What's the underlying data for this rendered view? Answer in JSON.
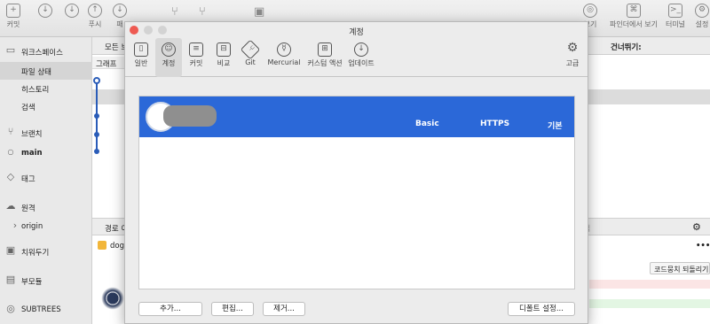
{
  "toolbar": {
    "commit_label": "커밋",
    "push_label": "푸시",
    "fetch_label": "패",
    "view_label": "보기",
    "finder_label": "파인더에서 보기",
    "terminal_label": "터미널",
    "settings_label": "설정"
  },
  "sidebar": {
    "workspace": "워크스페이스",
    "file_status": "파일 상태",
    "history": "히스토리",
    "search": "검색",
    "branches": "브랜치",
    "current_branch": "main",
    "tags": "태그",
    "remotes": "원격",
    "remote_origin": "origin",
    "stashes": "치워두기",
    "submodules": "부모듈",
    "subtrees": "SUBTREES"
  },
  "background": {
    "all_branches": "모든 브",
    "graph_header": "그래프",
    "skip_label": "건너뛰기:",
    "path_label": "경로 이",
    "file_item": "dog",
    "search_placeholder": "검색",
    "revert_button": "코드뭉치 되돌리기"
  },
  "prefs": {
    "window_title": "계정",
    "tabs": [
      {
        "label": "일반",
        "icon": "switch-icon"
      },
      {
        "label": "계정",
        "icon": "user-icon"
      },
      {
        "label": "커밋",
        "icon": "document-icon"
      },
      {
        "label": "비교",
        "icon": "compare-icon"
      },
      {
        "label": "Git",
        "icon": "git-icon"
      },
      {
        "label": "Mercurial",
        "icon": "mercurial-icon"
      },
      {
        "label": "커스텀 액션",
        "icon": "custom-action-icon"
      },
      {
        "label": "업데이트",
        "icon": "download-icon"
      },
      {
        "label": "고급",
        "icon": "gear-icon"
      }
    ],
    "account": {
      "type": "Basic",
      "protocol": "HTTPS",
      "default": "기본"
    },
    "buttons": {
      "add": "추가...",
      "edit": "편집...",
      "remove": "제거...",
      "set_default": "디폴트 설정..."
    }
  },
  "colors": {
    "selection_blue": "#2b68d8",
    "graph_blue": "#2a5cb8",
    "close_red": "#ee5a52"
  }
}
